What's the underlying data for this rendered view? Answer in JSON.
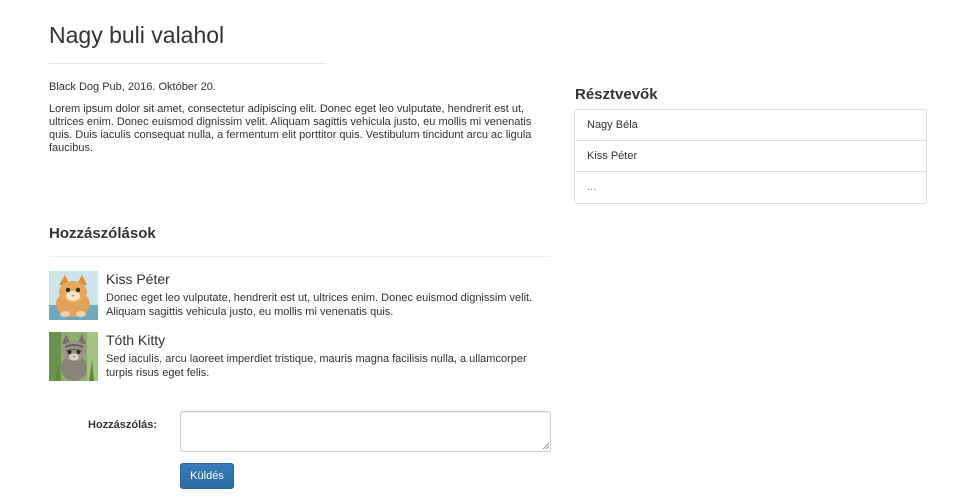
{
  "event": {
    "title": "Nagy buli valahol",
    "meta": "Black Dog Pub, 2016. Október 20.",
    "description": "Lorem ipsum dolor sit amet, consectetur adipiscing elit. Donec eget leo vulputate, hendrerit est ut, ultrices enim. Donec euismod dignissim velit. Aliquam sagittis vehicula justo, eu mollis mi venenatis quis. Duis iaculis consequat nulla, a fermentum elit porttitor quis. Vestibulum tincidunt arcu ac ligula faucibus."
  },
  "comments": {
    "heading": "Hozzászólások",
    "items": [
      {
        "author": "Kiss Péter",
        "text": "Donec eget leo vulputate, hendrerit est ut, ultrices enim. Donec euismod dignissim velit. Aliquam sagittis vehicula justo, eu mollis mi venenatis quis.",
        "avatar_icon": "orange-kitten-avatar"
      },
      {
        "author": "Tóth Kitty",
        "text": "Sed iaculis, arcu laoreet imperdiet tristique, mauris magna facilisis nulla, a ullamcorper turpis risus eget felis.",
        "avatar_icon": "tabby-kitten-avatar"
      }
    ]
  },
  "form": {
    "label": "Hozzászólás:",
    "value": "",
    "submit_label": "Küldés"
  },
  "participants": {
    "heading": "Résztvevők",
    "items": [
      "Nagy Béla",
      "Kiss Péter",
      "..."
    ]
  },
  "colors": {
    "accent": "#337ab7",
    "border": "#dddddd",
    "text": "#333333"
  }
}
